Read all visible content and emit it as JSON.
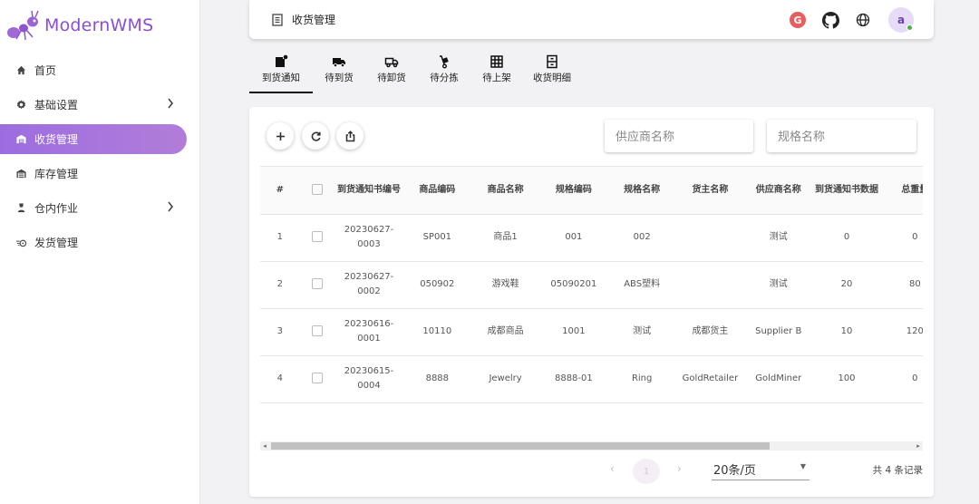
{
  "app": {
    "name": "ModernWMS"
  },
  "sidebar": {
    "items": [
      {
        "label": "首页",
        "icon": "home-icon",
        "active": false,
        "expandable": false
      },
      {
        "label": "基础设置",
        "icon": "gear-icon",
        "active": false,
        "expandable": true
      },
      {
        "label": "收货管理",
        "icon": "warehouse-icon",
        "active": true,
        "expandable": false
      },
      {
        "label": "库存管理",
        "icon": "inventory-icon",
        "active": false,
        "expandable": false
      },
      {
        "label": "仓内作业",
        "icon": "worker-icon",
        "active": false,
        "expandable": true
      },
      {
        "label": "发货管理",
        "icon": "shipping-icon",
        "active": false,
        "expandable": false
      }
    ]
  },
  "header": {
    "title": "收货管理",
    "icons": [
      "gitee-icon",
      "github-icon",
      "globe-icon"
    ],
    "gitee_letter": "G",
    "avatar_letter": "a"
  },
  "tabs": [
    {
      "label": "到货通知",
      "icon": "notice-icon",
      "active": true
    },
    {
      "label": "待到货",
      "icon": "truck-icon",
      "active": false
    },
    {
      "label": "待卸货",
      "icon": "unload-truck-icon",
      "active": false
    },
    {
      "label": "待分拣",
      "icon": "hand-truck-icon",
      "active": false
    },
    {
      "label": "待上架",
      "icon": "grid-icon",
      "active": false
    },
    {
      "label": "收货明细",
      "icon": "detail-icon",
      "active": false
    }
  ],
  "toolbar": {
    "buttons": [
      "add-icon",
      "refresh-icon",
      "export-icon"
    ],
    "search_supplier_placeholder": "供应商名称",
    "search_spec_placeholder": "规格名称"
  },
  "table": {
    "headers": [
      "#",
      "",
      "到货通知书编号",
      "商品编码",
      "商品名称",
      "规格编码",
      "规格名称",
      "货主名称",
      "供应商名称",
      "到货通知书数据",
      "总重量"
    ],
    "rows": [
      [
        "1",
        "",
        "20230627-0003",
        "SP001",
        "商品1",
        "001",
        "002",
        "",
        "测试",
        "0",
        "0"
      ],
      [
        "2",
        "",
        "20230627-0002",
        "050902",
        "游戏鞋",
        "05090201",
        "ABS塑料",
        "",
        "测试",
        "20",
        "80"
      ],
      [
        "3",
        "",
        "20230616-0001",
        "10110",
        "成都商品",
        "1001",
        "测试",
        "成都货主",
        "Supplier B",
        "10",
        "120"
      ],
      [
        "4",
        "",
        "20230615-0004",
        "8888",
        "Jewelry",
        "8888-01",
        "Ring",
        "GoldRetailer",
        "GoldMiner",
        "100",
        "0"
      ]
    ]
  },
  "pagination": {
    "prev": "‹",
    "current_page": "1",
    "next": "›",
    "page_size": "20条/页",
    "total_text": "共 4 条记录"
  },
  "colors": {
    "accent": "#9c6de0",
    "brand_text": "#8a4fd6"
  }
}
